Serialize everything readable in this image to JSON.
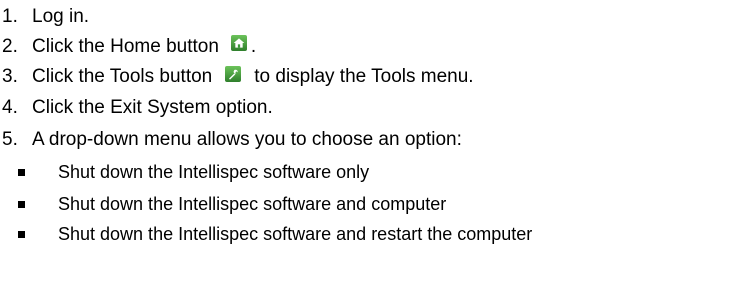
{
  "steps": [
    {
      "num": "1.",
      "text": "Log in."
    },
    {
      "num": "2.",
      "text": "Click the Home button",
      "after": "."
    },
    {
      "num": "3.",
      "text": "Click the Tools button",
      "after": "to display the Tools menu."
    },
    {
      "num": "4.",
      "text": "Click the Exit System option."
    },
    {
      "num": "5.",
      "text": "A drop-down menu allows you to choose an option:"
    }
  ],
  "options": [
    "Shut down the Intellispec software only",
    "Shut down the Intellispec software and computer",
    "Shut down the Intellispec software and restart the computer"
  ],
  "icons": {
    "home": {
      "name": "home-icon",
      "color": "#3c9a3a"
    },
    "tools": {
      "name": "wrench-icon",
      "color": "#3c9a3a"
    }
  }
}
